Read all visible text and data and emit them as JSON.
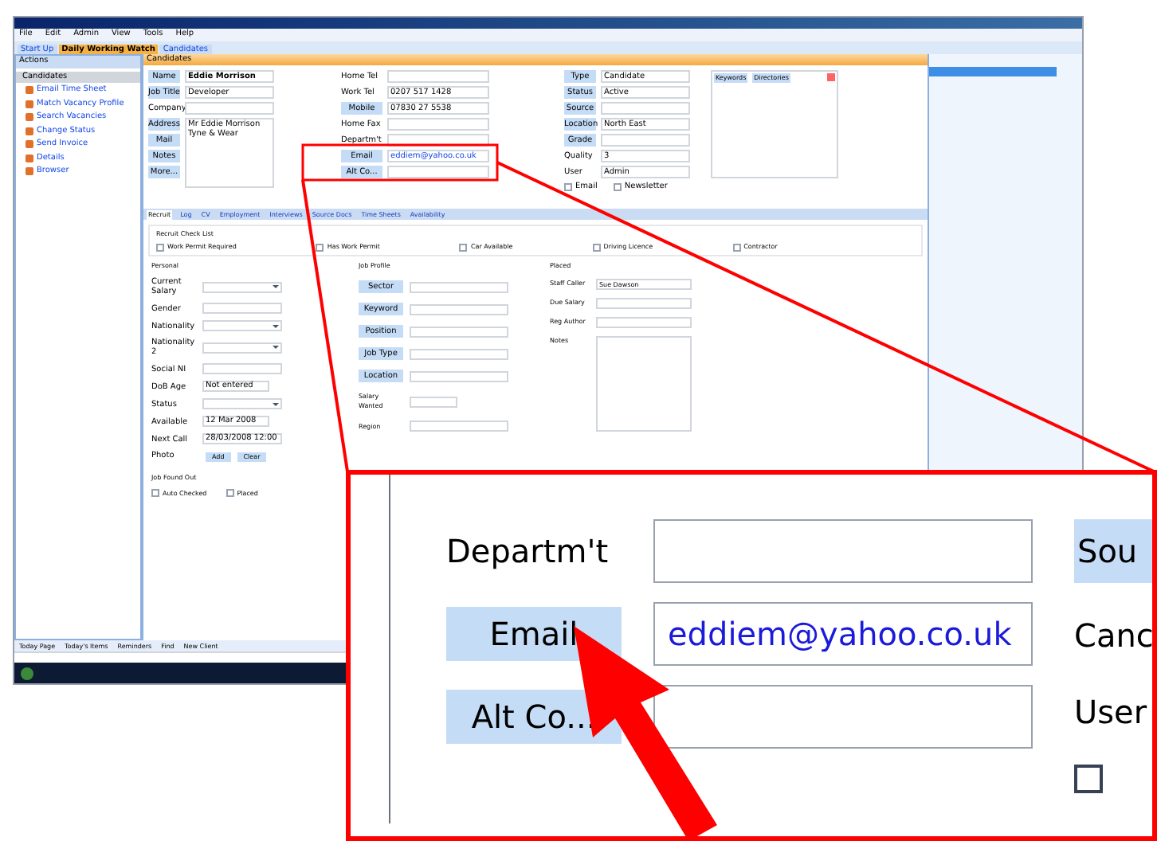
{
  "menu": [
    "File",
    "Edit",
    "Admin",
    "View",
    "Tools",
    "Help"
  ],
  "view_tabs": [
    {
      "label": "Start Up",
      "selected": false
    },
    {
      "label": "Daily Working Watch",
      "selected": true
    },
    {
      "label": "Candidates",
      "selected": false
    }
  ],
  "actions": {
    "title": "Actions",
    "group": "Candidates",
    "items": [
      "Email Time Sheet",
      "Match Vacancy Profile",
      "Search Vacancies",
      "Change Status",
      "Send Invoice",
      "Details",
      "Browser"
    ]
  },
  "record": {
    "header": "Candidates",
    "left": [
      {
        "label": "Name",
        "kind": "button",
        "value": "Eddie Morrison"
      },
      {
        "label": "Job Title",
        "kind": "button",
        "value": "Developer"
      },
      {
        "label": "Company",
        "kind": "label"
      }
    ],
    "address": {
      "label": "Address",
      "value": "Mr Eddie Morrison\nTyne & Wear"
    },
    "left_buttons": [
      "Mail",
      "Notes",
      "More..."
    ],
    "middle": [
      {
        "label": "Home Tel",
        "kind": "label"
      },
      {
        "label": "Work Tel",
        "kind": "label",
        "value": "0207 517 1428"
      },
      {
        "label": "Mobile",
        "kind": "button",
        "value": "07830 27 5538"
      },
      {
        "label": "Home Fax",
        "kind": "label"
      },
      {
        "label": "Departm't",
        "kind": "label"
      },
      {
        "label": "Email",
        "kind": "button",
        "value": "eddiem@yahoo.co.uk"
      },
      {
        "label": "Alt Co...",
        "kind": "button"
      }
    ],
    "right": [
      {
        "label": "Type",
        "kind": "button",
        "value": "Candidate"
      },
      {
        "label": "Status",
        "kind": "button",
        "value": "Active"
      },
      {
        "label": "Source",
        "kind": "button"
      },
      {
        "label": "Location",
        "kind": "button",
        "value": "North East"
      },
      {
        "label": "Grade",
        "kind": "button"
      },
      {
        "label": "Quality",
        "kind": "label",
        "value": "3"
      },
      {
        "label": "User",
        "kind": "label",
        "value": "Admin"
      }
    ],
    "flags": [
      {
        "label": "Email",
        "checked": false
      },
      {
        "label": "Newsletter",
        "checked": false
      }
    ],
    "side_tabs": [
      "Keywords",
      "Directories"
    ]
  },
  "detail_tabs": [
    {
      "label": "Recruit",
      "selected": true
    },
    {
      "label": "Log",
      "selected": false
    },
    {
      "label": "CV",
      "selected": false
    },
    {
      "label": "Employment",
      "selected": false
    },
    {
      "label": "Interviews",
      "selected": false
    },
    {
      "label": "Source Docs",
      "selected": false
    },
    {
      "label": "Time Sheets",
      "selected": false
    },
    {
      "label": "Availability",
      "selected": false
    }
  ],
  "checklist": {
    "title": "Recruit Check List",
    "items": [
      {
        "label": "Work Permit Required",
        "checked": false
      },
      {
        "label": "Has Work Permit",
        "checked": false
      },
      {
        "label": "Car Available",
        "checked": false
      },
      {
        "label": "Driving Licence",
        "checked": false
      },
      {
        "label": "Contractor",
        "checked": false
      }
    ]
  },
  "personal": {
    "title": "Personal",
    "rows": [
      {
        "label": "Current Salary",
        "kind": "dropdown",
        "value": ""
      },
      {
        "label": "Gender",
        "kind": "field",
        "value": ""
      },
      {
        "label": "Nationality",
        "kind": "dropdown",
        "value": ""
      },
      {
        "label": "Nationality 2",
        "kind": "dropdown",
        "value": ""
      },
      {
        "label": "Social NI",
        "kind": "field",
        "value": ""
      },
      {
        "label": "DoB Age",
        "kind": "date",
        "value": "Not entered"
      },
      {
        "label": "Status",
        "kind": "dropdown",
        "value": ""
      },
      {
        "label": "Available",
        "kind": "date",
        "value": "12 Mar 2008"
      },
      {
        "label": "Next Call",
        "kind": "field",
        "value": "28/03/2008 12:00"
      }
    ],
    "photo": {
      "label": "Photo",
      "buttons": [
        "Add",
        "Clear"
      ]
    },
    "found": {
      "title": "Job Found Out",
      "items": [
        {
          "label": "Auto Checked",
          "checked": false
        },
        {
          "label": "Placed",
          "checked": false
        }
      ]
    }
  },
  "job_profile": {
    "title": "Job Profile",
    "rows": [
      {
        "label": "Sector",
        "kind": "button"
      },
      {
        "label": "Keyword",
        "kind": "button"
      },
      {
        "label": "Position",
        "kind": "button"
      },
      {
        "label": "Job Type",
        "kind": "button"
      },
      {
        "label": "Location",
        "kind": "button"
      },
      {
        "label": "Salary Wanted",
        "kind": "dropdown"
      },
      {
        "label": "Region",
        "kind": "label"
      }
    ]
  },
  "placed": {
    "title": "Placed",
    "rows": [
      {
        "label": "Staff Caller",
        "value": "Sue Dawson"
      },
      {
        "label": "Due Salary",
        "value": ""
      },
      {
        "label": "Reg Author",
        "value": ""
      },
      {
        "label": "Notes",
        "value": ""
      }
    ]
  },
  "bottom_toolbar": [
    "Today Page",
    "Today's Items",
    "Reminders",
    "Find",
    "New Client"
  ],
  "inset": {
    "rows": [
      {
        "label": "Departm't",
        "kind": "label",
        "value": ""
      },
      {
        "label": "Email",
        "kind": "button",
        "value": "eddiem@yahoo.co.uk"
      },
      {
        "label": "Alt Co...",
        "kind": "button",
        "value": ""
      }
    ],
    "right_button": "Sou",
    "right_texts": [
      "Canc",
      "User"
    ],
    "checkbox": {
      "checked": false
    }
  }
}
